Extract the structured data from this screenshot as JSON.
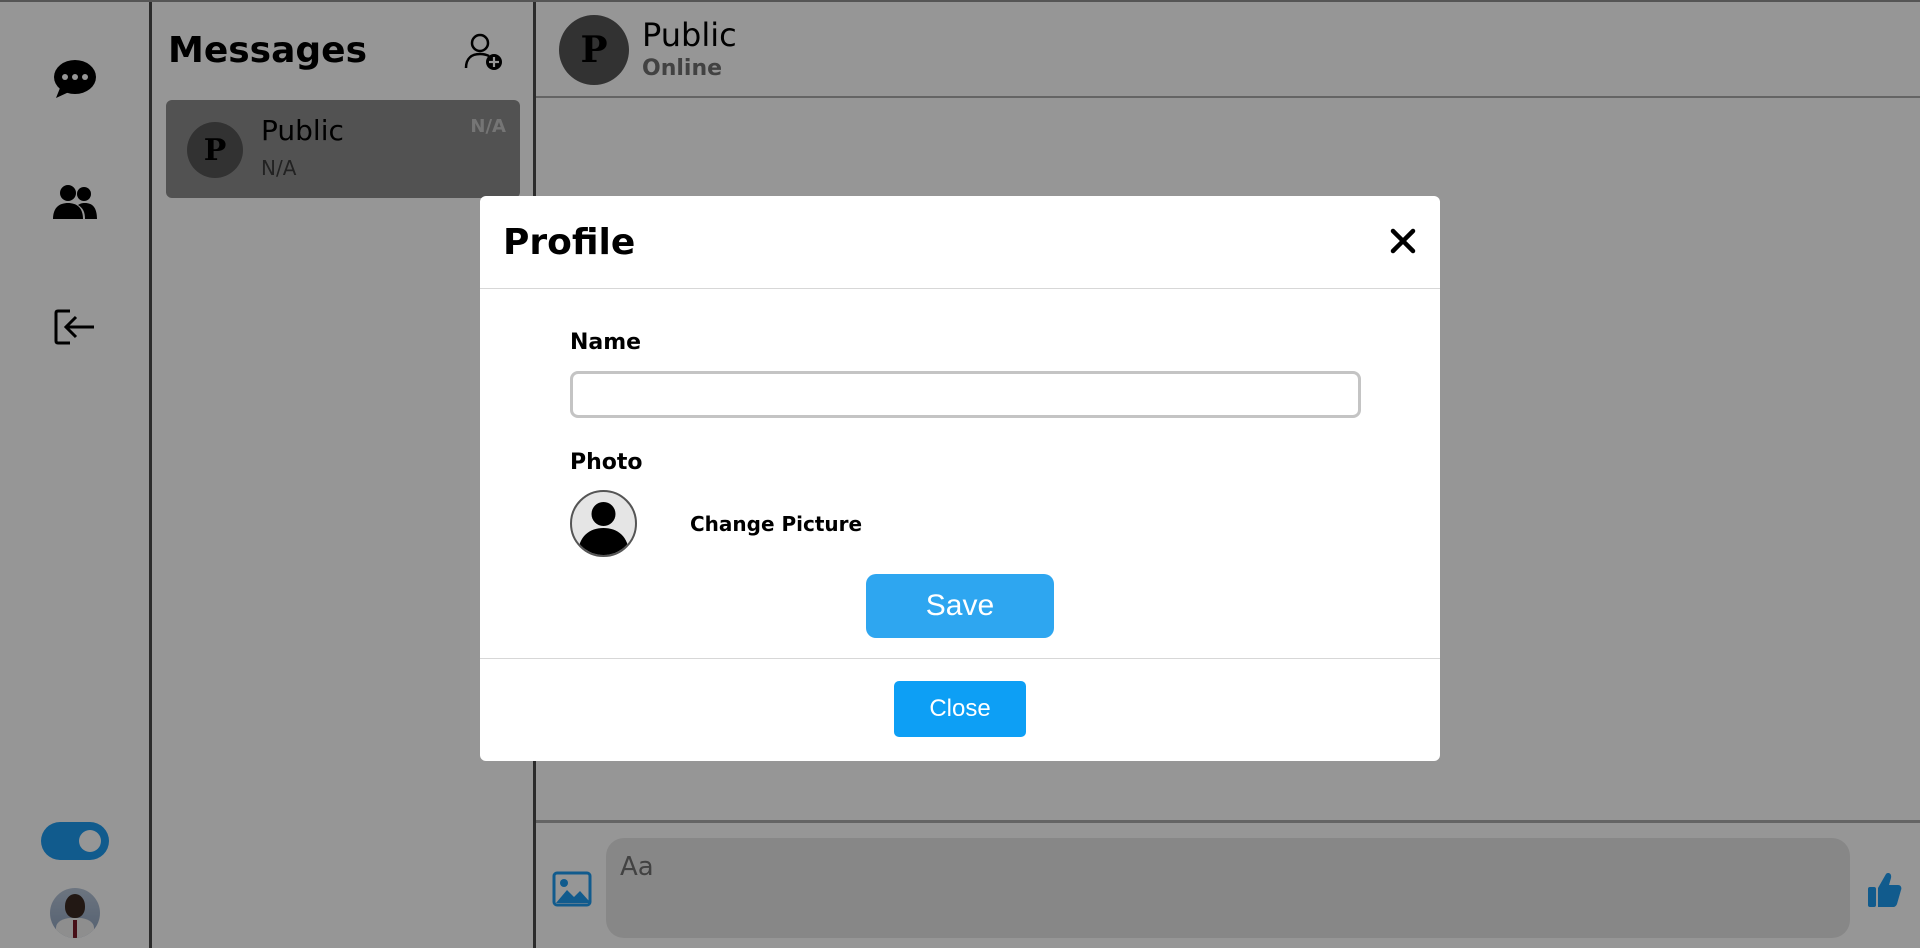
{
  "sidebar": {
    "icons": [
      "chat-icon",
      "users-icon",
      "logout-icon"
    ],
    "accent": "#1d9bf0"
  },
  "conversations": {
    "title": "Messages",
    "items": [
      {
        "initial": "P",
        "name": "Public",
        "last_message": "N/A",
        "time": "N/A"
      }
    ]
  },
  "chat": {
    "contact_initial": "P",
    "contact_name": "Public",
    "status": "Online",
    "input_placeholder": "Aa"
  },
  "modal": {
    "title": "Profile",
    "name_label": "Name",
    "name_value": "",
    "photo_label": "Photo",
    "change_picture": "Change Picture",
    "save_label": "Save",
    "close_label": "Close",
    "save_color": "#2ea6f0",
    "close_color": "#0d9ff5"
  }
}
